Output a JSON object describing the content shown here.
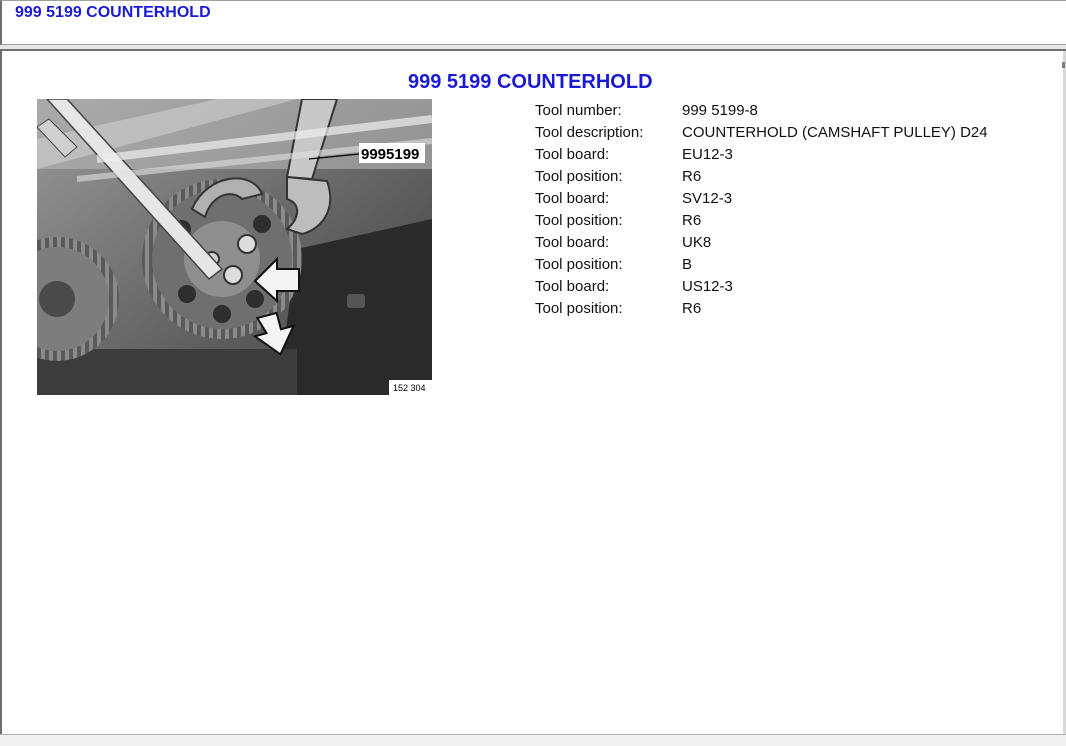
{
  "header": {
    "title": "999 5199 COUNTERHOLD"
  },
  "main": {
    "title": "999 5199 COUNTERHOLD",
    "photo": {
      "callout": "9995199",
      "code": "152 304"
    },
    "rows": [
      {
        "label": "Tool number:",
        "value": "999 5199-8"
      },
      {
        "label": "Tool description:",
        "value": "COUNTERHOLD (CAMSHAFT PULLEY) D24"
      },
      {
        "label": "Tool board:",
        "value": "EU12-3"
      },
      {
        "label": "Tool position:",
        "value": "R6"
      },
      {
        "label": "Tool board:",
        "value": "SV12-3"
      },
      {
        "label": "Tool position:",
        "value": "R6"
      },
      {
        "label": "Tool board:",
        "value": "UK8"
      },
      {
        "label": "Tool position:",
        "value": "B"
      },
      {
        "label": "Tool board:",
        "value": "US12-3"
      },
      {
        "label": "Tool position:",
        "value": "R6"
      }
    ]
  },
  "colors": {
    "title_blue": "#1a1ad4",
    "frame_gray": "#6e6e6e"
  }
}
